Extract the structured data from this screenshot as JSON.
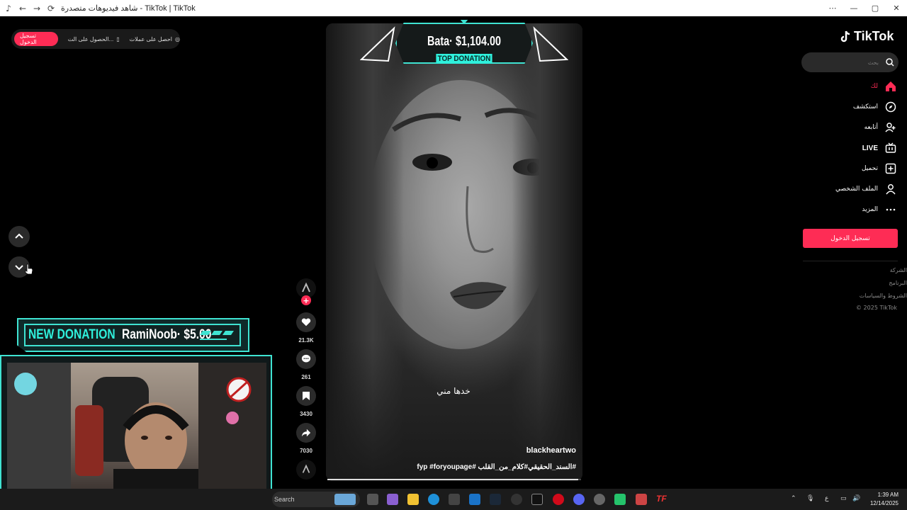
{
  "window": {
    "title": "شاهد فيديوهات متصدرة - TikTok | TikTok"
  },
  "topbar": {
    "login": "تسجيل الدخول",
    "get_app": "الحصول على الت...",
    "get_coins": "احصل على عملات"
  },
  "video": {
    "top_donation_amount": "Bata· $1,104.00",
    "top_donation_label": "TOP DONATION",
    "subtitle": "خدها مني",
    "author": "blackheartwo",
    "caption": "#السند_الحقيقي#كلام_من_القلب #fyp #foryoupage",
    "progress": 0.99
  },
  "actions": {
    "likes": "21.3K",
    "comments": "261",
    "saves": "3430",
    "shares": "7030"
  },
  "sidebar": {
    "brand": "TikTok",
    "search_placeholder": "بحث",
    "items": [
      {
        "label": "لك",
        "icon": "home-icon",
        "active": true
      },
      {
        "label": "استكشف",
        "icon": "compass-icon"
      },
      {
        "label": "أتابعه",
        "icon": "user-plus-icon"
      },
      {
        "label": "LIVE",
        "icon": "live-tv-icon"
      },
      {
        "label": "تحميل",
        "icon": "upload-icon"
      },
      {
        "label": "الملف الشخصي",
        "icon": "profile-icon"
      },
      {
        "label": "المزيد",
        "icon": "more-icon"
      }
    ],
    "login_button": "تسجيل الدخول",
    "footer": [
      "الشركة",
      "البرنامج",
      "الشروط والسياسات",
      "© 2025 TikTok"
    ]
  },
  "overlay": {
    "new_donation_label": "NEW DONATION",
    "new_donation_amount": "RamiNoob· $5.00"
  },
  "taskbar": {
    "search_label": "Search",
    "time": "1:39 AM",
    "date": "12/14/2025",
    "lang": "ع"
  },
  "colors": {
    "accent": "#fe2c55",
    "overlay_teal": "#3fe3d2"
  }
}
